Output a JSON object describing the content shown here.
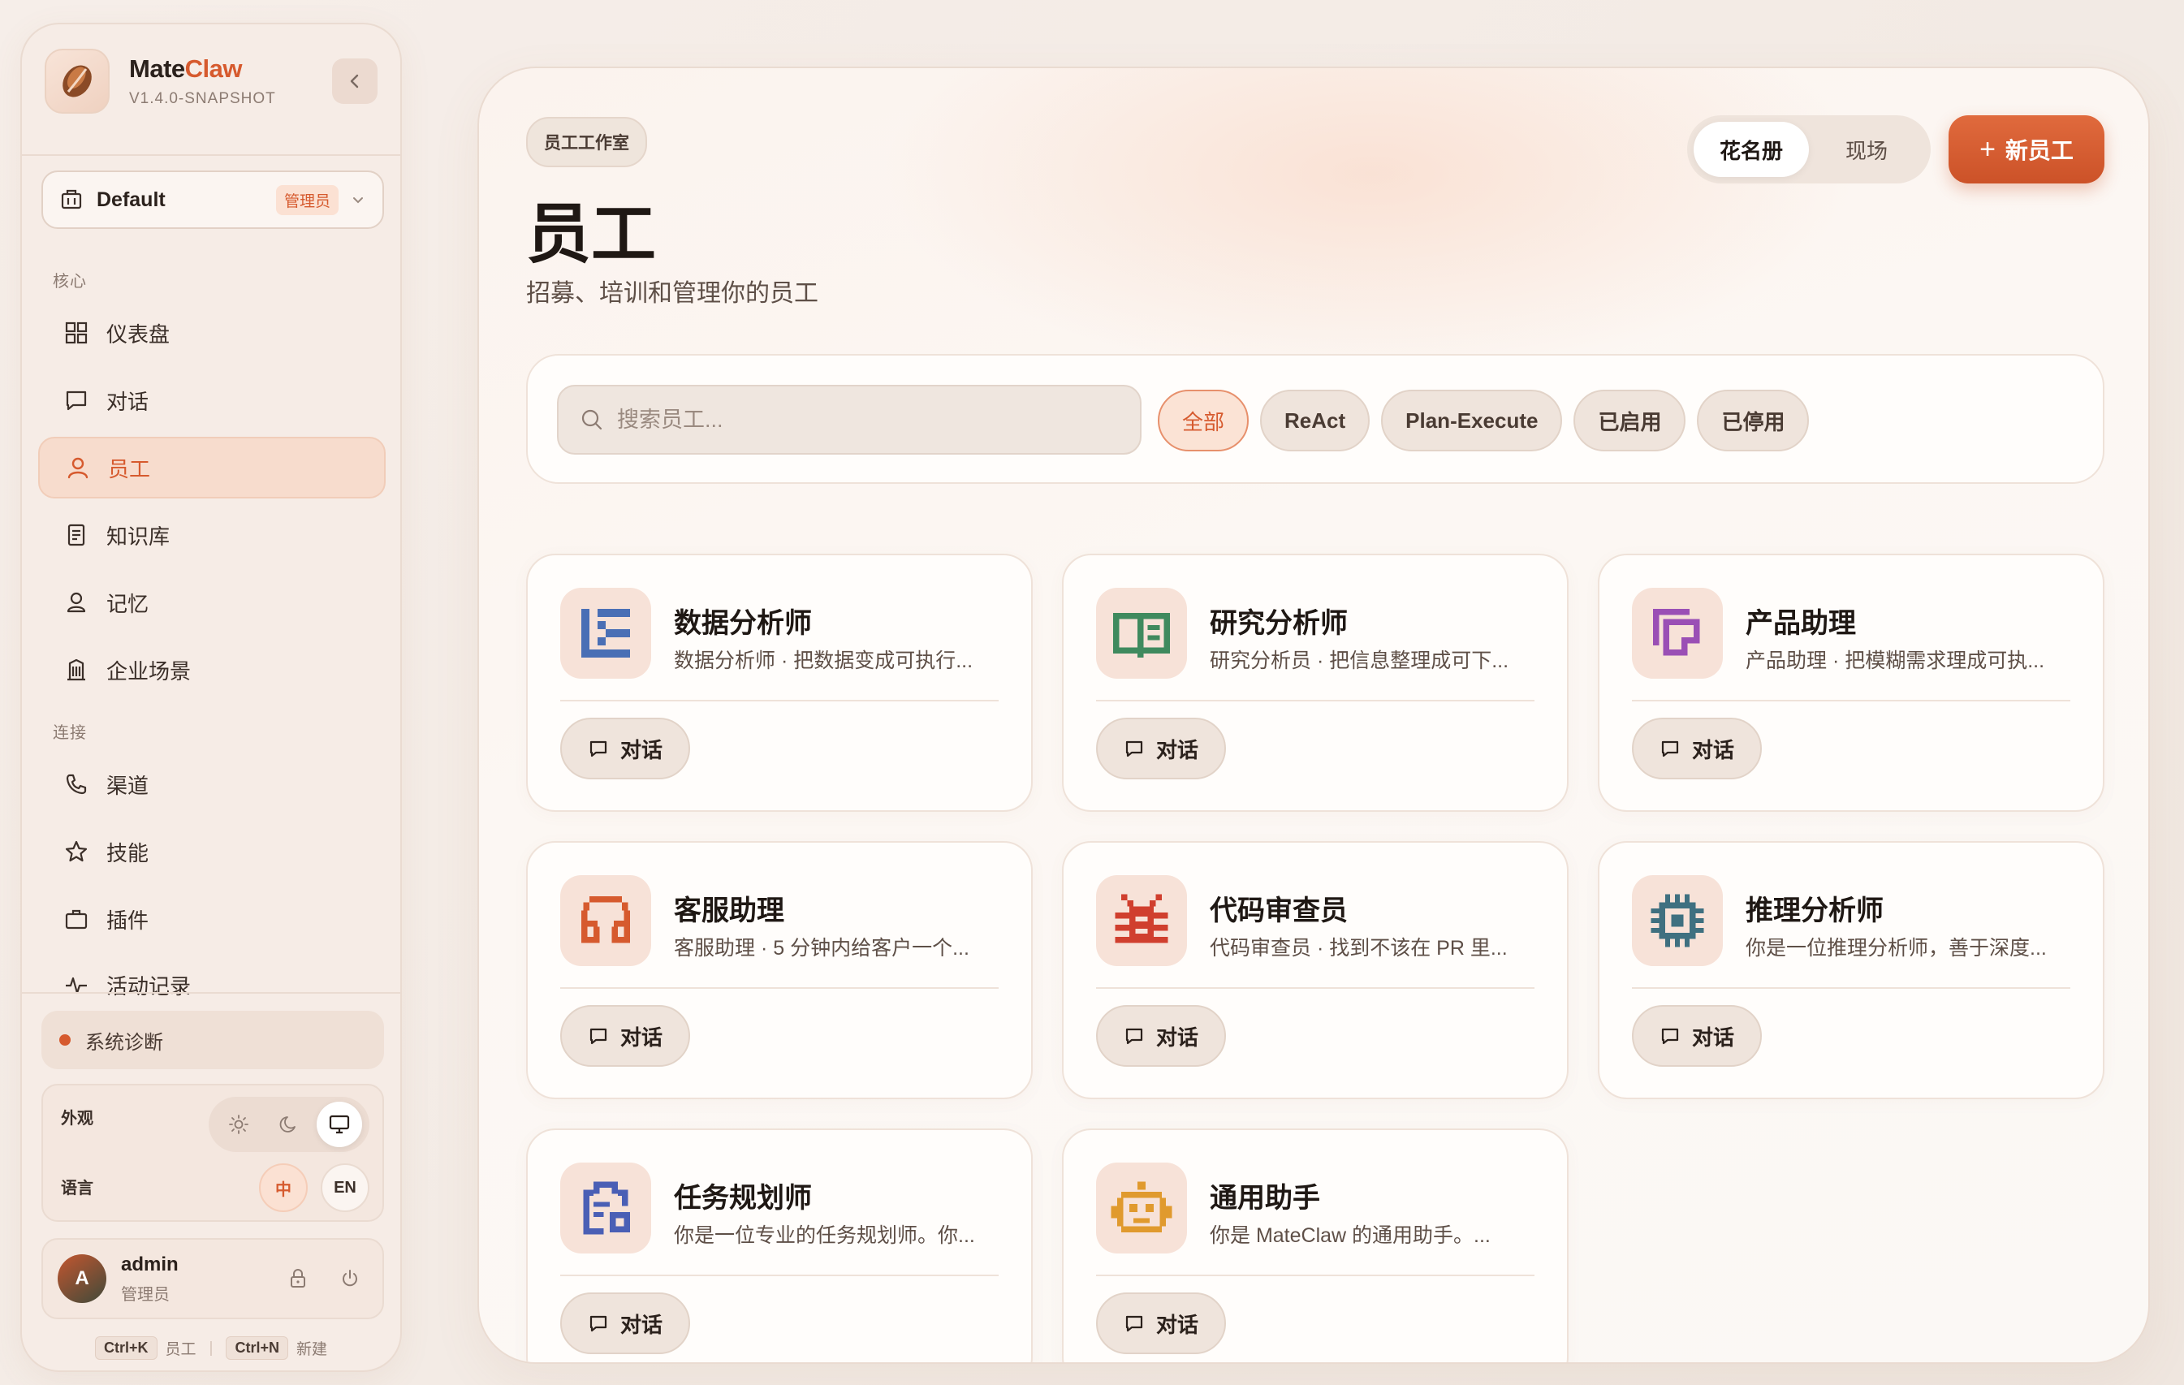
{
  "brand": {
    "name_primary": "Mate",
    "name_accent": "Claw",
    "version": "V1.4.0-SNAPSHOT"
  },
  "workspace": {
    "name": "Default",
    "badge": "管理员"
  },
  "sidebar": {
    "sections": [
      {
        "title": "核心"
      },
      {
        "title": "连接"
      }
    ],
    "items": [
      {
        "label": "仪表盘",
        "icon": "grid-icon"
      },
      {
        "label": "对话",
        "icon": "message-icon"
      },
      {
        "label": "员工",
        "icon": "user-icon"
      },
      {
        "label": "知识库",
        "icon": "document-icon"
      },
      {
        "label": "记忆",
        "icon": "person-icon"
      },
      {
        "label": "企业场景",
        "icon": "building-icon"
      },
      {
        "label": "渠道",
        "icon": "phone-icon"
      },
      {
        "label": "技能",
        "icon": "star-icon"
      },
      {
        "label": "插件",
        "icon": "briefcase-icon"
      },
      {
        "label": "活动记录",
        "icon": "activity-icon"
      }
    ],
    "diagnostics": "系统诊断",
    "appearance_label": "外观",
    "language_label": "语言",
    "lang_zh": "中",
    "lang_en": "EN",
    "user": {
      "initial": "A",
      "name": "admin",
      "role": "管理员"
    },
    "shortcuts": [
      {
        "key": "Ctrl+K",
        "label": "员工"
      },
      {
        "key": "Ctrl+N",
        "label": "新建"
      }
    ]
  },
  "header": {
    "kicker": "员工工作室",
    "title": "员工",
    "subtitle": "招募、培训和管理你的员工",
    "views": [
      "花名册",
      "现场"
    ],
    "new_button": "新员工"
  },
  "filters": {
    "search_placeholder": "搜索员工...",
    "chips": [
      "全部",
      "ReAct",
      "Plan-Execute",
      "已启用",
      "已停用"
    ]
  },
  "employees": [
    {
      "name": "数据分析师",
      "desc": "数据分析师 · 把数据变成可执行...",
      "icon": "data-list-icon",
      "color": "#4a6fb5",
      "chat": "对话"
    },
    {
      "name": "研究分析师",
      "desc": "研究分析员 · 把信息整理成可下...",
      "icon": "book-icon",
      "color": "#3f8a5e",
      "chat": "对话"
    },
    {
      "name": "产品助理",
      "desc": "产品助理 · 把模糊需求理成可执...",
      "icon": "product-icon",
      "color": "#9a4fb5",
      "chat": "对话"
    },
    {
      "name": "客服助理",
      "desc": "客服助理 · 5 分钟内给客户一个...",
      "icon": "headphones-icon",
      "color": "#d65a2e",
      "chat": "对话"
    },
    {
      "name": "代码审查员",
      "desc": "代码审查员 · 找到不该在 PR 里...",
      "icon": "bug-icon",
      "color": "#d03f2e",
      "chat": "对话"
    },
    {
      "name": "推理分析师",
      "desc": "你是一位推理分析师，善于深度...",
      "icon": "chip-icon",
      "color": "#3f7080",
      "chat": "对话"
    },
    {
      "name": "任务规划师",
      "desc": "你是一位专业的任务规划师。你...",
      "icon": "clipboard-icon",
      "color": "#4a5fb5",
      "chat": "对话"
    },
    {
      "name": "通用助手",
      "desc": "你是 MateClaw 的通用助手。...",
      "icon": "robot-icon",
      "color": "#e09a2e",
      "chat": "对话"
    }
  ]
}
